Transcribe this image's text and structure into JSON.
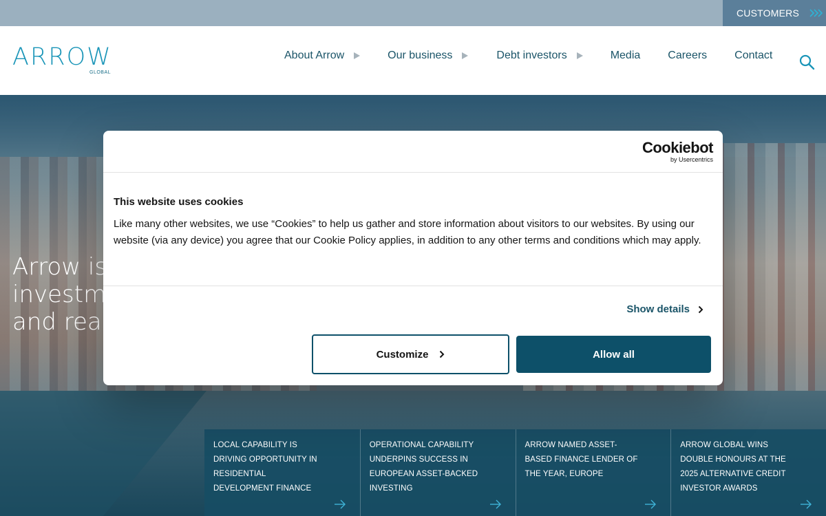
{
  "topbar": {
    "customers_label": "CUSTOMERS",
    "customers_icon": "double-chevron-right-icon"
  },
  "header": {
    "logo_text": "ARROW",
    "logo_subtext": "GLOBAL",
    "nav": [
      {
        "label": "About Arrow",
        "has_submenu": true
      },
      {
        "label": "Our business",
        "has_submenu": true
      },
      {
        "label": "Debt investors",
        "has_submenu": true
      },
      {
        "label": "Media",
        "has_submenu": false
      },
      {
        "label": "Careers",
        "has_submenu": false
      },
      {
        "label": "Contact",
        "has_submenu": false
      }
    ],
    "search_icon": "search-icon"
  },
  "hero": {
    "heading_lines": [
      "Arrow is",
      "investme",
      "and real e"
    ]
  },
  "news_cards": [
    {
      "title": "LOCAL CAPABILITY IS DRIVING OPPORTUNITY IN RESIDENTIAL DEVELOPMENT FINANCE"
    },
    {
      "title": "OPERATIONAL CAPABILITY UNDERPINS SUCCESS IN EUROPEAN ASSET-BACKED INVESTING"
    },
    {
      "title": "ARROW NAMED ASSET-BASED FINANCE LENDER OF THE YEAR, EUROPE"
    },
    {
      "title": "ARROW GLOBAL WINS DOUBLE HONOURS AT THE 2025 ALTERNATIVE CREDIT INVESTOR AWARDS"
    }
  ],
  "cookie_dialog": {
    "brand_main": "Cookiebot",
    "brand_sub": "by Usercentrics",
    "title": "This website uses cookies",
    "body": "Like many other websites, we use “Cookies” to help us gather and store information about visitors to our websites. By using our website (via any device) you agree that our Cookie Policy applies, in addition to any other terms and conditions which may apply.",
    "show_details_label": "Show details",
    "customize_label": "Customize",
    "allow_all_label": "Allow all"
  },
  "colors": {
    "brand_teal": "#1a95b8",
    "dark_teal": "#0d5069",
    "topbar": "#9bb0bf",
    "customers_bg": "#5b7f9a",
    "card_bg": "#174d64"
  }
}
